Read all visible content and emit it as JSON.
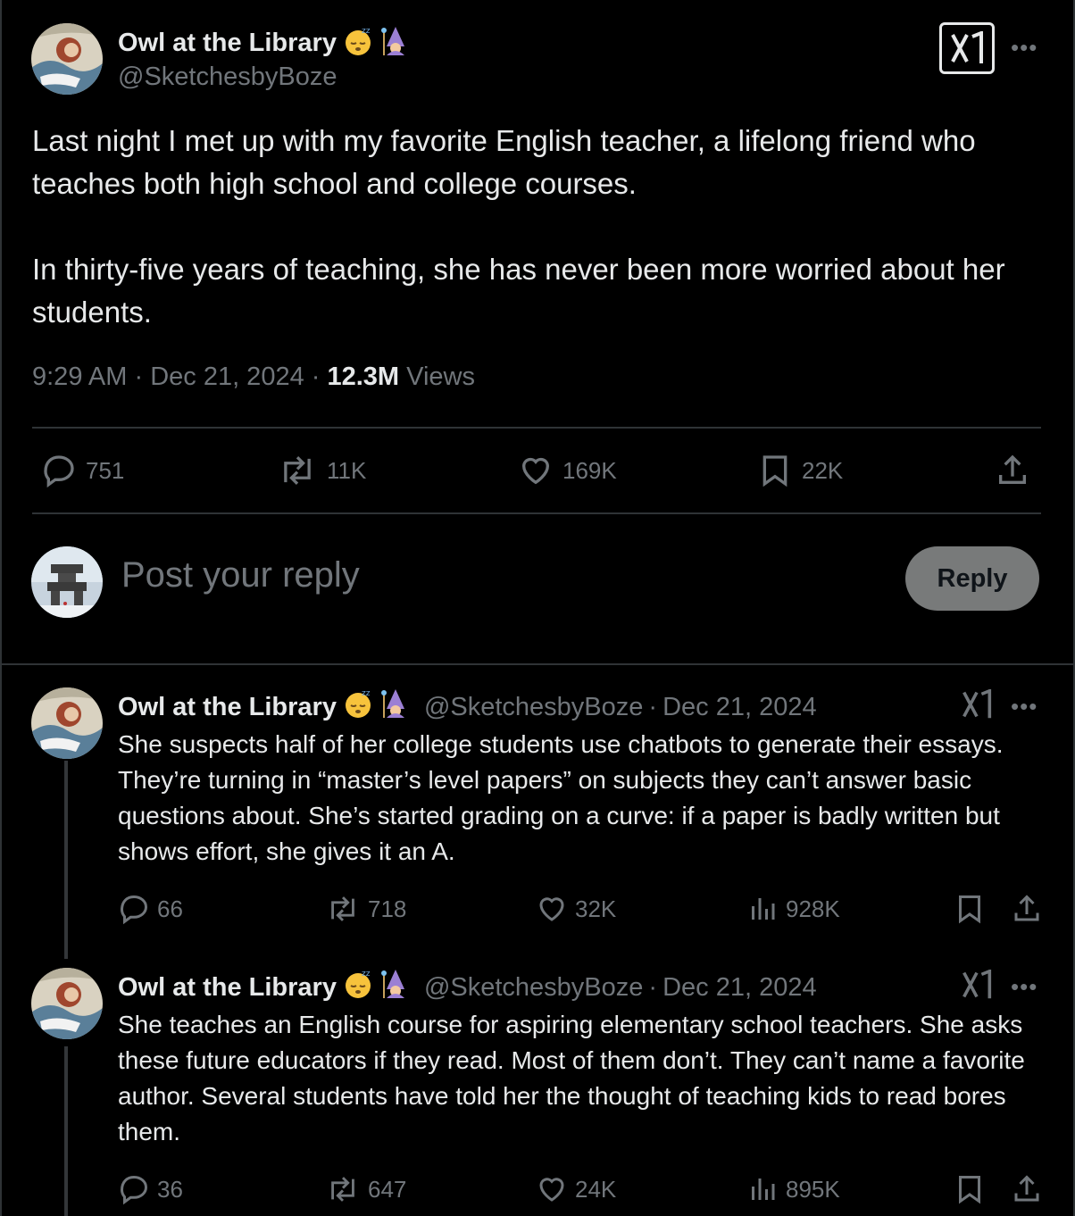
{
  "colors": {
    "background": "#000000",
    "text": "#e7e9ea",
    "muted": "#71767b",
    "border": "#2f3336"
  },
  "main_post": {
    "author_name": "Owl at the Library",
    "handle": "@SketchesbyBoze",
    "paragraph1": "Last night I met up with my favorite English teacher, a lifelong friend who teaches both high school and college courses.",
    "paragraph2": "In thirty-five years of teaching, she has never been more worried about her students.",
    "time": "9:29 AM",
    "date": "Dec 21, 2024",
    "views_count": "12.3M",
    "views_label": "Views",
    "stats": {
      "replies": "751",
      "reposts": "11K",
      "likes": "169K",
      "bookmarks": "22K"
    }
  },
  "reply_composer": {
    "placeholder": "Post your reply",
    "button_label": "Reply"
  },
  "thread": [
    {
      "author_name": "Owl at the Library",
      "handle": "@SketchesbyBoze",
      "date": "Dec 21, 2024",
      "text": "She suspects half of her college students use chatbots to generate their essays. They’re turning in “master’s level papers” on subjects they can’t answer basic questions about. She’s started grading on a curve: if a paper is badly written but shows effort, she gives it an A.",
      "stats": {
        "replies": "66",
        "reposts": "718",
        "likes": "32K",
        "views": "928K"
      }
    },
    {
      "author_name": "Owl at the Library",
      "handle": "@SketchesbyBoze",
      "date": "Dec 21, 2024",
      "text": "She teaches an English course for aspiring elementary school teachers. She asks these future educators if they read. Most of them don’t. They can’t name a favorite author. Several students have told her the thought of teaching kids to read bores them.",
      "stats": {
        "replies": "36",
        "reposts": "647",
        "likes": "24K",
        "views": "895K"
      }
    }
  ],
  "icons": [
    "reply-icon",
    "repost-icon",
    "like-icon",
    "bookmark-icon",
    "share-icon",
    "views-icon",
    "grok-icon",
    "more-icon",
    "sleeping-face-emoji",
    "mage-emoji"
  ]
}
